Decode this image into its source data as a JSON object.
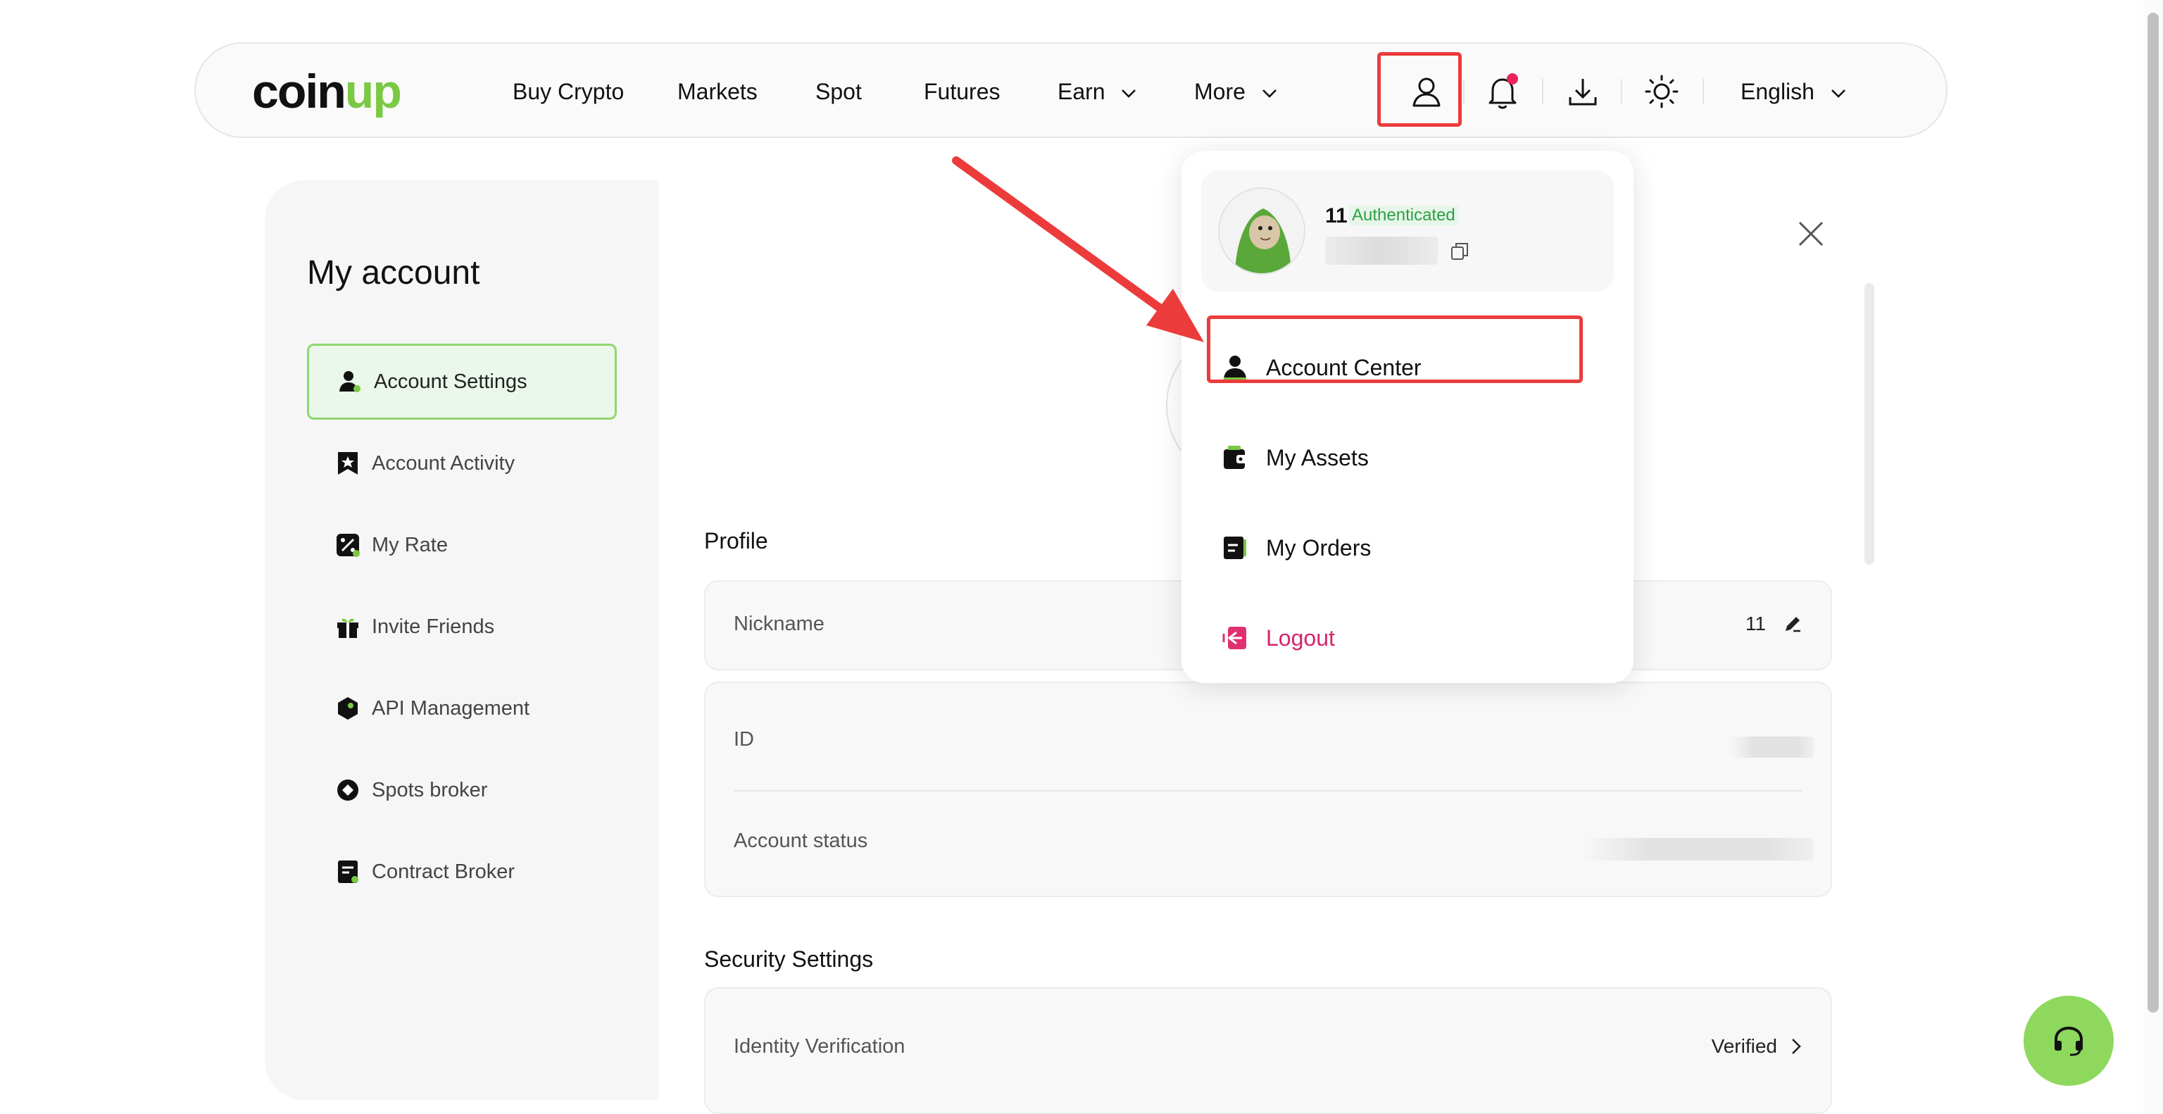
{
  "brand": {
    "logo_part1": "coin",
    "logo_part2": "up"
  },
  "nav": {
    "buy_crypto": "Buy Crypto",
    "markets": "Markets",
    "spot": "Spot",
    "futures": "Futures",
    "earn": "Earn",
    "more": "More",
    "language": "English"
  },
  "sidebar": {
    "title": "My account",
    "items": [
      {
        "label": "Account Settings",
        "icon": "user-settings-icon"
      },
      {
        "label": "Account Activity",
        "icon": "star-bookmark-icon"
      },
      {
        "label": "My Rate",
        "icon": "percent-icon"
      },
      {
        "label": "Invite Friends",
        "icon": "gift-icon"
      },
      {
        "label": "API Management",
        "icon": "api-hexagon-icon"
      },
      {
        "label": "Spots broker",
        "icon": "spot-circle-icon"
      },
      {
        "label": "Contract Broker",
        "icon": "contract-icon"
      }
    ]
  },
  "main": {
    "profile_title": "Profile",
    "nickname_label": "Nickname",
    "nickname_value": "11",
    "id_label": "ID",
    "account_status_label": "Account status",
    "security_title": "Security Settings",
    "identity_label": "Identity Verification",
    "identity_value": "Verified"
  },
  "dropdown": {
    "user_name": "11",
    "auth_badge": "Authenticated",
    "items": [
      {
        "label": "Account Center",
        "icon": "user-icon"
      },
      {
        "label": "My Assets",
        "icon": "wallet-icon"
      },
      {
        "label": "My Orders",
        "icon": "orders-icon"
      },
      {
        "label": "Logout",
        "icon": "logout-icon"
      }
    ]
  },
  "colors": {
    "accent_green": "#7ac943",
    "support_green": "#8ed85e",
    "highlight_red": "#ec3b3b",
    "logout_pink": "#d6246b",
    "auth_green": "#2f9e44"
  }
}
